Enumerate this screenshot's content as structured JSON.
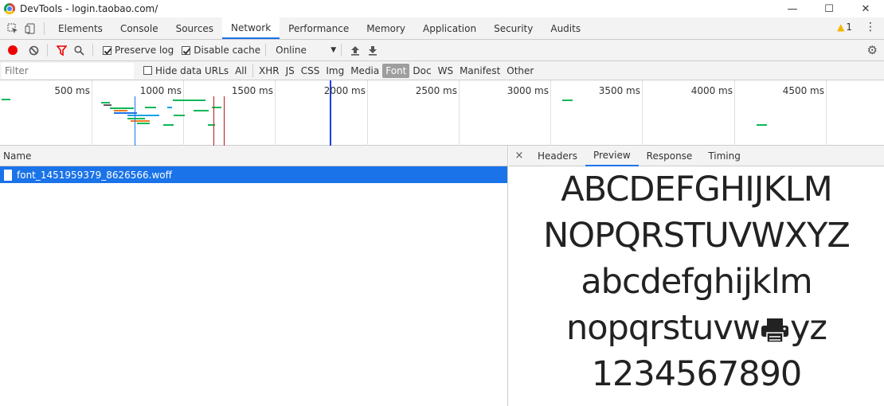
{
  "window": {
    "title": "DevTools - login.taobao.com/",
    "minimize": "—",
    "maximize": "☐",
    "close": "✕"
  },
  "tabs": [
    {
      "label": "Elements"
    },
    {
      "label": "Console"
    },
    {
      "label": "Sources"
    },
    {
      "label": "Network"
    },
    {
      "label": "Performance"
    },
    {
      "label": "Memory"
    },
    {
      "label": "Application"
    },
    {
      "label": "Security"
    },
    {
      "label": "Audits"
    }
  ],
  "active_tab": "Network",
  "warnings": {
    "count": "1"
  },
  "toolbar": {
    "preserve_log": "Preserve log",
    "preserve_log_checked": true,
    "disable_cache": "Disable cache",
    "disable_cache_checked": true,
    "throttle": "Online"
  },
  "filter": {
    "placeholder": "Filter",
    "hide_data_urls": "Hide data URLs",
    "types": [
      "All",
      "XHR",
      "JS",
      "CSS",
      "Img",
      "Media",
      "Font",
      "Doc",
      "WS",
      "Manifest",
      "Other"
    ],
    "active_type": "Font"
  },
  "timeline": {
    "ticks": [
      "500 ms",
      "1000 ms",
      "1500 ms",
      "2000 ms",
      "2500 ms",
      "3000 ms",
      "3500 ms",
      "4000 ms",
      "4500 ms"
    ]
  },
  "requests": {
    "header": "Name",
    "rows": [
      {
        "name": "font_1451959379_8626566.woff",
        "selected": true
      }
    ]
  },
  "detail": {
    "close": "×",
    "tabs": [
      "Headers",
      "Preview",
      "Response",
      "Timing"
    ],
    "active": "Preview",
    "preview_lines": [
      "ABCDEFGHIJKLM",
      "NOPQRSTUVWXYZ",
      "abcdefghijklm",
      "nopqrstuvw",
      "1234567890"
    ],
    "line4_suffix": "yz"
  }
}
